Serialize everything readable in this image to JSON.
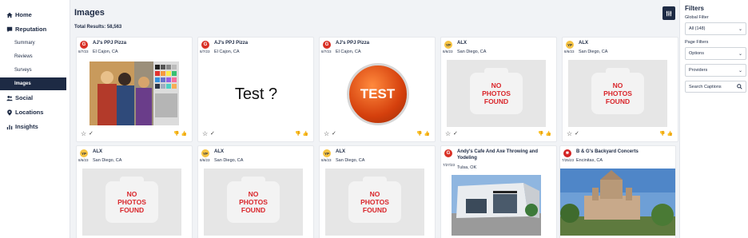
{
  "sidebar": {
    "items": [
      {
        "label": "Home",
        "icon": "home-icon"
      },
      {
        "label": "Reputation",
        "icon": "chat-icon"
      },
      {
        "label": "Social",
        "icon": "users-icon"
      },
      {
        "label": "Locations",
        "icon": "pin-icon"
      },
      {
        "label": "Insights",
        "icon": "chart-icon"
      }
    ],
    "reputation_sub": [
      "Summary",
      "Reviews",
      "Surveys",
      "Images"
    ],
    "active_sub": "Images"
  },
  "header": {
    "title": "Images",
    "total": "Total Results: 58,563"
  },
  "cards": [
    {
      "source": "G",
      "name": "AJ's PPJ Pizza",
      "date": "8/7/23",
      "location": "El Cajon, CA",
      "photo": "test-image"
    },
    {
      "source": "G",
      "name": "AJ's PPJ Pizza",
      "date": "8/7/23",
      "location": "El Cajon, CA",
      "photo": "Test ?"
    },
    {
      "source": "G",
      "name": "AJ's PPJ Pizza",
      "date": "8/7/23",
      "location": "El Cajon, CA",
      "photo": "TEST"
    },
    {
      "source": "yp",
      "name": "ALX",
      "date": "8/6/23",
      "location": "San Diego, CA",
      "photo": "none"
    },
    {
      "source": "yp",
      "name": "ALX",
      "date": "8/6/23",
      "location": "San Diego, CA",
      "photo": "none"
    },
    {
      "source": "yp",
      "name": "ALX",
      "date": "8/6/23",
      "location": "San Diego, CA",
      "photo": "none"
    },
    {
      "source": "yp",
      "name": "ALX",
      "date": "8/6/23",
      "location": "San Diego, CA",
      "photo": "none"
    },
    {
      "source": "yp",
      "name": "ALX",
      "date": "8/6/23",
      "location": "San Diego, CA",
      "photo": "none"
    },
    {
      "source": "G",
      "name": "Andy's Cafe And Axe Throwing and Yodeling",
      "date": "7/27/23",
      "location": "Tulsa, OK",
      "photo": "building"
    },
    {
      "source": "yelp",
      "name": "B & G's Backyard Concerts",
      "date": "7/25/23",
      "location": "Encinitas, CA",
      "photo": "temple"
    }
  ],
  "no_photos_text": "NO PHOTOS FOUND",
  "filters": {
    "title": "Filters",
    "global_label": "Global Filter",
    "global_value": "All (148)",
    "page_label": "Page Filters",
    "options_value": "Options",
    "providers_value": "Providers",
    "search_placeholder": "Search Captions"
  },
  "colors": {
    "navy": "#1d2a44",
    "google_red": "#d93025",
    "yp_yellow": "#f6c343",
    "no_photo_red": "#d9262b"
  }
}
